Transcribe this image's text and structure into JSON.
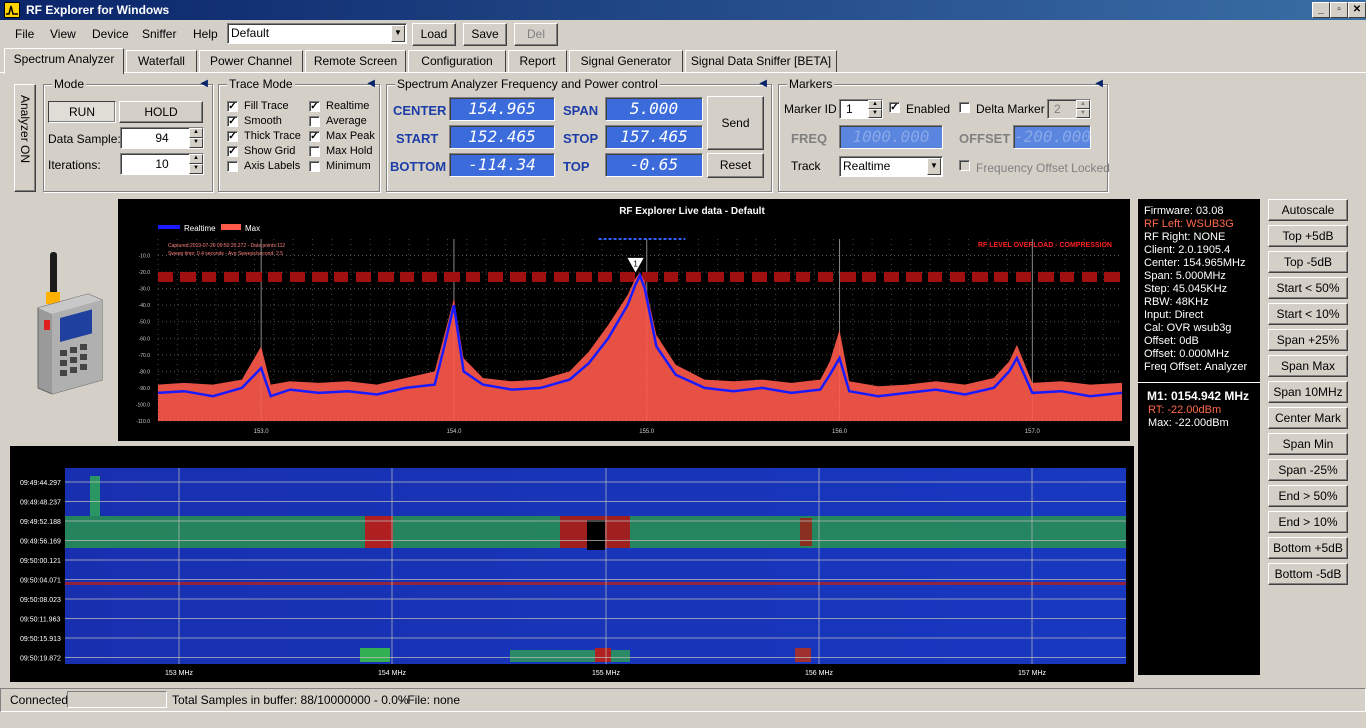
{
  "window": {
    "title": "RF Explorer for Windows",
    "min": "_",
    "max": "▫",
    "close": "✕"
  },
  "menu": {
    "items": [
      "File",
      "View",
      "Device",
      "Sniffer",
      "Help"
    ]
  },
  "preset": {
    "value": "Default",
    "load": "Load",
    "save": "Save",
    "del": "Del"
  },
  "tabs": [
    "Spectrum Analyzer",
    "Waterfall",
    "Power Channel",
    "Remote Screen",
    "Configuration",
    "Report",
    "Signal Generator",
    "Signal Data Sniffer [BETA]"
  ],
  "side_label": "Analyzer ON",
  "mode": {
    "title": "Mode",
    "run": "RUN",
    "hold": "HOLD",
    "data_sample_label": "Data Sample:",
    "data_sample": "94",
    "iterations_label": "Iterations:",
    "iterations": "10"
  },
  "trace": {
    "title": "Trace Mode",
    "options": [
      {
        "label": "Fill Trace",
        "checked": true
      },
      {
        "label": "Smooth",
        "checked": true
      },
      {
        "label": "Thick Trace",
        "checked": true
      },
      {
        "label": "Show Grid",
        "checked": true
      },
      {
        "label": "Axis Labels",
        "checked": false
      },
      {
        "label": "Realtime",
        "checked": true
      },
      {
        "label": "Average",
        "checked": false
      },
      {
        "label": "Max Peak",
        "checked": true
      },
      {
        "label": "Max Hold",
        "checked": false
      },
      {
        "label": "Minimum",
        "checked": false
      }
    ]
  },
  "freq": {
    "title": "Spectrum Analyzer Frequency and Power control",
    "center_label": "CENTER",
    "center": "154.965",
    "span_label": "SPAN",
    "span": "5.000",
    "start_label": "START",
    "start": "152.465",
    "stop_label": "STOP",
    "stop": "157.465",
    "bottom_label": "BOTTOM",
    "bottom": "-114.34",
    "top_label": "TOP",
    "top": "-0.65",
    "send": "Send",
    "reset": "Reset"
  },
  "markers": {
    "title": "Markers",
    "marker_id_label": "Marker ID",
    "marker_id": "1",
    "enabled_label": "Enabled",
    "enabled": true,
    "delta_label": "Delta Marker",
    "delta": false,
    "delta_value": "2",
    "freq_label": "FREQ",
    "freq_value": "1000.000",
    "offset_label": "OFFSET",
    "offset_value": "-200.000",
    "track_label": "Track",
    "track_value": "Realtime",
    "offset_locked_label": "Frequency Offset Locked"
  },
  "spectrum": {
    "title": "RF Explorer Live data - Default",
    "legend_realtime": "Realtime",
    "legend_max": "Max",
    "capture_line1": "Captured:2019-07-26  09:50:20.272  -  Data  points:112",
    "capture_line2": "Sweep time: 0.4  seconds  -  Avg Sweeps/second: 2.5",
    "overload": "RF LEVEL OVERLOAD - COMPRESSION",
    "marker_label": "1",
    "colors": {
      "realtime": "#1a1aff",
      "max": "#ff5a4a",
      "overload": "#ff2020"
    }
  },
  "chart_data": {
    "type": "area",
    "x_range": [
      152.465,
      157.465
    ],
    "ylim": [
      -110,
      0
    ],
    "y_ticks": [
      "-10.0",
      "-20.0",
      "-30.0",
      "-40.0",
      "-50.0",
      "-60.0",
      "-70.0",
      "-80.0",
      "-90.0",
      "-100.0",
      "-110.0"
    ],
    "x_ticks": [
      "153.0",
      "154.0",
      "155.0",
      "156.0",
      "157.0"
    ],
    "series": [
      {
        "name": "Realtime",
        "x": [
          152.465,
          152.6,
          152.75,
          152.9,
          153.0,
          153.05,
          153.15,
          153.3,
          153.45,
          153.6,
          153.75,
          153.9,
          153.95,
          154.0,
          154.05,
          154.15,
          154.3,
          154.45,
          154.6,
          154.7,
          154.8,
          154.9,
          154.94,
          154.965,
          154.99,
          155.05,
          155.15,
          155.3,
          155.45,
          155.6,
          155.75,
          155.9,
          155.95,
          156.0,
          156.05,
          156.2,
          156.35,
          156.5,
          156.65,
          156.8,
          156.88,
          156.92,
          157.0,
          157.15,
          157.3,
          157.465
        ],
        "y": [
          -93,
          -92,
          -95,
          -90,
          -78,
          -95,
          -91,
          -93,
          -92,
          -94,
          -90,
          -88,
          -65,
          -40,
          -80,
          -88,
          -91,
          -90,
          -85,
          -75,
          -60,
          -40,
          -28,
          -22,
          -30,
          -65,
          -82,
          -90,
          -92,
          -90,
          -93,
          -91,
          -82,
          -72,
          -92,
          -95,
          -93,
          -91,
          -94,
          -90,
          -80,
          -72,
          -93,
          -92,
          -95,
          -93
        ]
      },
      {
        "name": "Max",
        "x": [
          152.465,
          152.6,
          152.75,
          152.9,
          153.0,
          153.05,
          153.15,
          153.3,
          153.45,
          153.6,
          153.75,
          153.9,
          153.95,
          154.0,
          154.05,
          154.15,
          154.3,
          154.45,
          154.6,
          154.7,
          154.8,
          154.9,
          154.94,
          154.965,
          154.99,
          155.05,
          155.15,
          155.3,
          155.45,
          155.6,
          155.75,
          155.9,
          155.95,
          156.0,
          156.05,
          156.2,
          156.35,
          156.5,
          156.65,
          156.8,
          156.88,
          156.92,
          157.0,
          157.15,
          157.3,
          157.465
        ],
        "y": [
          -88,
          -87,
          -88,
          -85,
          -65,
          -88,
          -86,
          -87,
          -86,
          -88,
          -84,
          -80,
          -58,
          -36,
          -72,
          -84,
          -86,
          -85,
          -80,
          -68,
          -52,
          -34,
          -24,
          -20,
          -26,
          -58,
          -76,
          -85,
          -86,
          -85,
          -87,
          -85,
          -74,
          -55,
          -86,
          -89,
          -88,
          -86,
          -88,
          -84,
          -74,
          -64,
          -87,
          -86,
          -88,
          -87
        ]
      }
    ]
  },
  "waterfall": {
    "times": [
      "09:49:44.297",
      "09:49:48.237",
      "09:49:52.188",
      "09:49:56.169",
      "09:50:00.121",
      "09:50:04.071",
      "09:50:08.023",
      "09:50:11.963",
      "09:50:15.913",
      "09:50:19.872"
    ],
    "freqs": [
      "153 MHz",
      "154 MHz",
      "155 MHz",
      "156 MHz",
      "157 MHz"
    ]
  },
  "info": {
    "lines": [
      "Firmware: 03.08",
      "RF Left: WSUB3G",
      "RF Right: NONE",
      "Client: 2.0.1905.4",
      "Center: 154.965MHz",
      "Span: 5.000MHz",
      "Step: 45.045KHz",
      "RBW: 48KHz",
      "Input: Direct",
      "Cal: OVR wsub3g",
      "Offset: 0dB",
      "Offset: 0.000MHz",
      "Freq Offset: Analyzer"
    ],
    "m1": "M1: 0154.942 MHz",
    "rt": "RT: -22.00dBm",
    "max": "Max: -22.00dBm",
    "highlight": "#ff6a4a"
  },
  "right_buttons": [
    "Autoscale",
    "Top +5dB",
    "Top -5dB",
    "Start < 50%",
    "Start < 10%",
    "Span +25%",
    "Span Max",
    "Span 10MHz",
    "Center Mark",
    "Span Min",
    "Span -25%",
    "End > 50%",
    "End > 10%",
    "Bottom +5dB",
    "Bottom -5dB"
  ],
  "status": {
    "connected": "Connected",
    "samples": "Total Samples in buffer: 88/10000000 - 0.0%",
    "file": "- File: none"
  }
}
